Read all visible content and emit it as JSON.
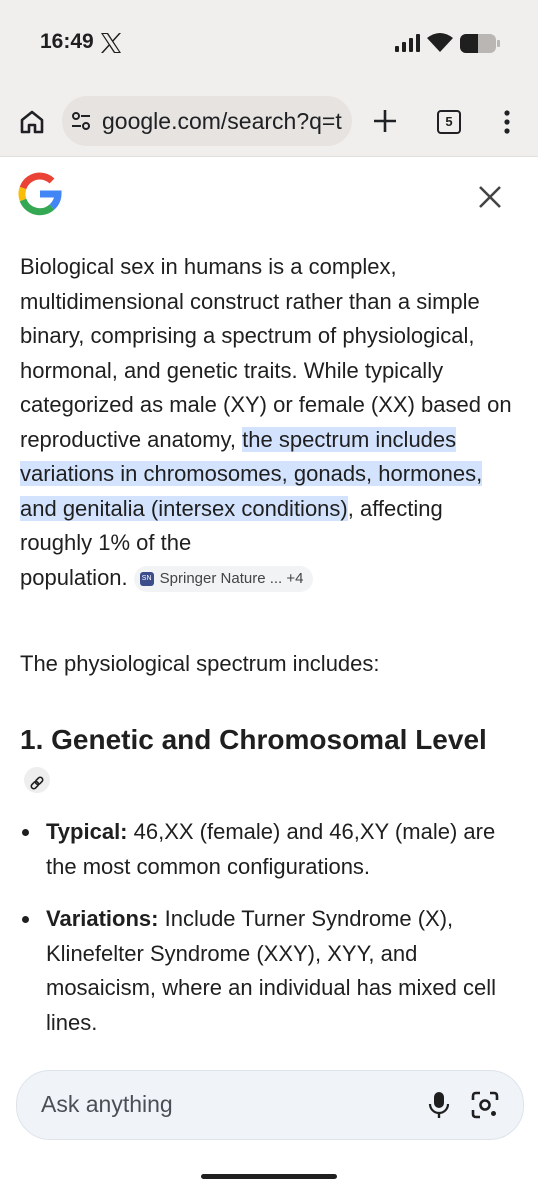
{
  "status": {
    "time": "16:49"
  },
  "browser": {
    "url": "google.com/search?q=t",
    "tab_count": "5"
  },
  "answer": {
    "p1_part1": "Biological sex in humans is a complex, multidimensional construct rather than a simple binary, comprising a spectrum of physiological, hormonal, and genetic traits. While typically categorized as male (XY) or female (XX) based on reproductive anatomy, ",
    "p1_highlight": "the spectrum includes variations in chromosomes, gonads, hormones, and genitalia (intersex conditions)",
    "p1_part2": ", affecting roughly 1% of the",
    "p1_part3": "population.",
    "source_chip": "Springer Nature ... +4",
    "p2": "The physiological spectrum includes:",
    "heading": "1. Genetic and Chromosomal Level",
    "bullets": [
      {
        "label": "Typical:",
        "text": " 46,XX (female) and 46,XY (male) are the most common configurations."
      },
      {
        "label": "Variations:",
        "text": " Include Turner Syndrome (X), Klinefelter Syndrome (XXY), XYY, and mosaicism, where an individual has mixed cell lines."
      }
    ]
  },
  "askbar": {
    "placeholder": "Ask anything"
  },
  "icons": {
    "home": "home-icon",
    "tune": "tune-icon",
    "newtab": "plus-icon",
    "tabs": "tabs-icon",
    "menu": "more-vert-icon",
    "google": "google-g-icon",
    "close": "close-icon",
    "link": "link-icon",
    "mic": "mic-icon",
    "lens": "lens-icon"
  },
  "colors": {
    "highlight": "#d3e3fd",
    "chrome_bg": "#f1efee",
    "text": "#1f1f1f"
  }
}
